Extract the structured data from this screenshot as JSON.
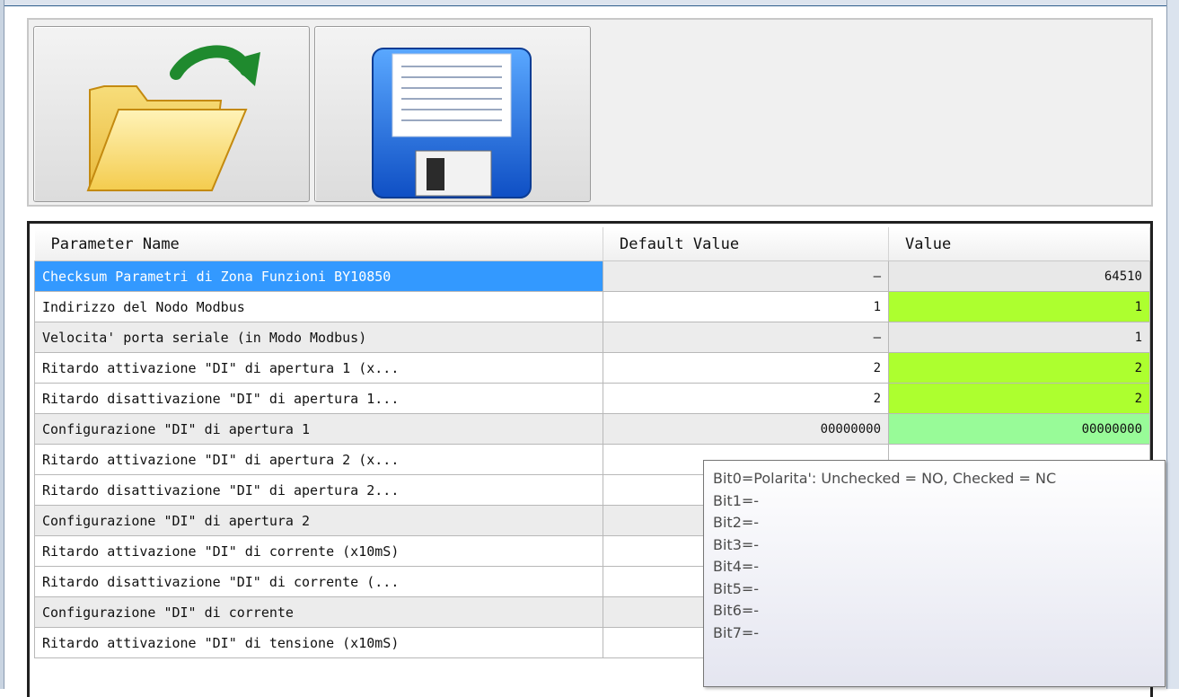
{
  "toolbar": {
    "open_icon": "folder-open-arrow-icon",
    "save_icon": "floppy-disk-icon"
  },
  "grid": {
    "columns": [
      "Parameter Name",
      "Default Value",
      "Value"
    ],
    "rows": [
      {
        "name": "Checksum Parametri di Zona Funzioni BY10850",
        "default": "–",
        "value": "64510",
        "style": "gray",
        "value_style": "v-gray",
        "selected": true
      },
      {
        "name": "Indirizzo del Nodo Modbus",
        "default": "1",
        "value": "1",
        "style": "white",
        "value_style": "v-lime"
      },
      {
        "name": "Velocita' porta seriale (in Modo Modbus)",
        "default": "–",
        "value": "1",
        "style": "gray",
        "value_style": "v-gray"
      },
      {
        "name": "Ritardo attivazione \"DI\" di apertura 1 (x...",
        "default": "2",
        "value": "2",
        "style": "white",
        "value_style": "v-lime"
      },
      {
        "name": "Ritardo disattivazione \"DI\" di apertura 1...",
        "default": "2",
        "value": "2",
        "style": "white",
        "value_style": "v-lime"
      },
      {
        "name": "Configurazione \"DI\" di apertura 1",
        "default": "00000000",
        "value": "00000000",
        "style": "gray",
        "value_style": "v-light"
      },
      {
        "name": "Ritardo attivazione \"DI\" di apertura 2 (x...",
        "default": "",
        "value": "",
        "style": "white",
        "value_style": ""
      },
      {
        "name": "Ritardo disattivazione \"DI\" di apertura 2...",
        "default": "",
        "value": "",
        "style": "white",
        "value_style": ""
      },
      {
        "name": "Configurazione \"DI\" di apertura 2",
        "default": "",
        "value": "",
        "style": "gray",
        "value_style": ""
      },
      {
        "name": "Ritardo attivazione \"DI\" di corrente (x10mS)",
        "default": "",
        "value": "",
        "style": "white",
        "value_style": ""
      },
      {
        "name": "Ritardo disattivazione \"DI\" di corrente (...",
        "default": "",
        "value": "",
        "style": "white",
        "value_style": ""
      },
      {
        "name": "Configurazione \"DI\" di corrente",
        "default": "",
        "value": "",
        "style": "gray",
        "value_style": ""
      },
      {
        "name": "Ritardo attivazione \"DI\" di tensione (x10mS)",
        "default": "",
        "value": "",
        "style": "white",
        "value_style": ""
      }
    ]
  },
  "tooltip": {
    "lines": [
      "Bit0=Polarita': Unchecked = NO, Checked = NC",
      "Bit1=-",
      "Bit2=-",
      "Bit3=-",
      "Bit4=-",
      "Bit5=-",
      "Bit6=-",
      "Bit7=-"
    ]
  },
  "colors": {
    "selection": "#3399ff",
    "value_lime": "#adff2f",
    "value_light_green": "#98fb98"
  }
}
